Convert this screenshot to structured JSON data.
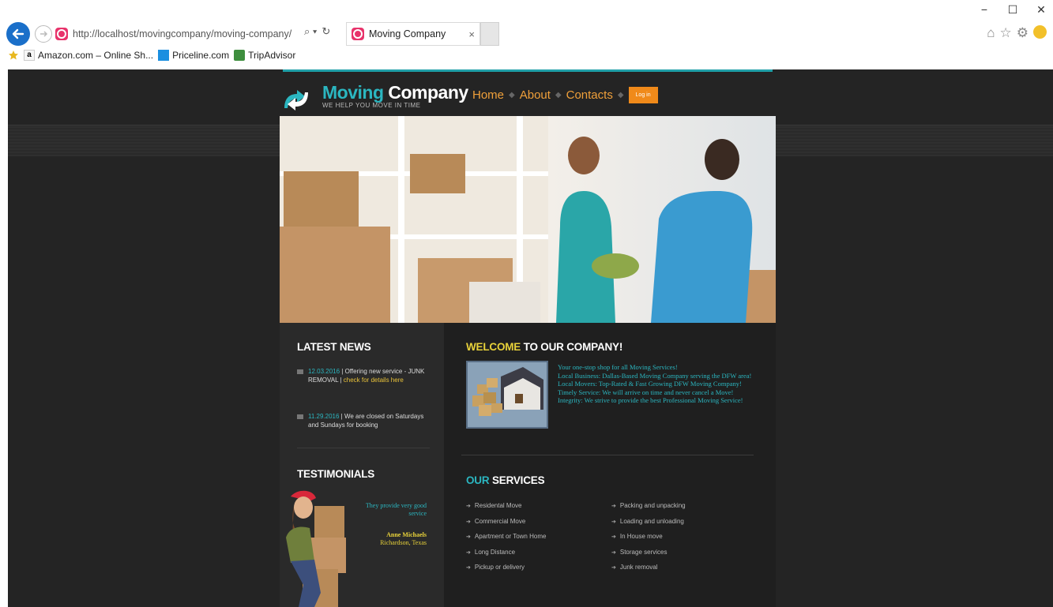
{
  "browser": {
    "url": "http://localhost/movingcompany/moving-company/",
    "tab_title": "Moving Company",
    "tab_close": "×",
    "search_glyph": "⌕ ▾",
    "refresh_glyph": "↻",
    "window_controls": {
      "minimize": "−",
      "maximize": "☐",
      "close": "✕"
    },
    "favorites": [
      {
        "label": "Amazon.com – Online Sh..."
      },
      {
        "label": "Priceline.com"
      },
      {
        "label": "TripAdvisor"
      }
    ]
  },
  "site": {
    "logo": {
      "part1": "Moving",
      "part2": "Company",
      "tagline": "WE HELP YOU MOVE IN TIME"
    },
    "menu": {
      "home": "Home",
      "about": "About",
      "contacts": "Contacts",
      "separator": "◆",
      "login": "Log in"
    },
    "latest_news": {
      "title": "LATEST NEWS",
      "items": [
        {
          "date": "12.03.2016",
          "text": " | Offering new service - JUNK REMOVAL | ",
          "link": "check for details here"
        },
        {
          "date": "11.29.2016",
          "text": " | We are closed on Saturdays and Sundays for booking",
          "link": ""
        }
      ]
    },
    "testimonials": {
      "title": "TESTIMONIALS",
      "quote": "They provide very good service",
      "name": "Anne Michaels",
      "location": "Richardson, Texas"
    },
    "welcome": {
      "title_highlight": "WELCOME",
      "title_rest": " TO OUR COMPANY!",
      "lines": [
        "Your one-stop shop for all Moving Services!",
        "Local Business: Dallas-Based Moving Company serving the DFW area!",
        "Local Movers: Top-Rated & Fast Growing DFW Moving Company!",
        "Timely Service: We will arrive on time and never cancel a Move!",
        "Integrity: We strive to provide the best Professional Moving Service!"
      ]
    },
    "services": {
      "title_highlight": "OUR",
      "title_rest": " SERVICES",
      "col1": [
        "Residental Move",
        "Commercial Move",
        "Apartment or Town Home",
        "Long Distance",
        "Pickup or delivery"
      ],
      "col2": [
        "Packing and unpacking",
        "Loading and unloading",
        "In House move",
        "Storage services",
        "Junk removal"
      ]
    }
  },
  "colors": {
    "accent_teal": "#2bb6c0",
    "accent_orange": "#f08a1a",
    "accent_yellow": "#e8d23a",
    "background": "#242424"
  }
}
